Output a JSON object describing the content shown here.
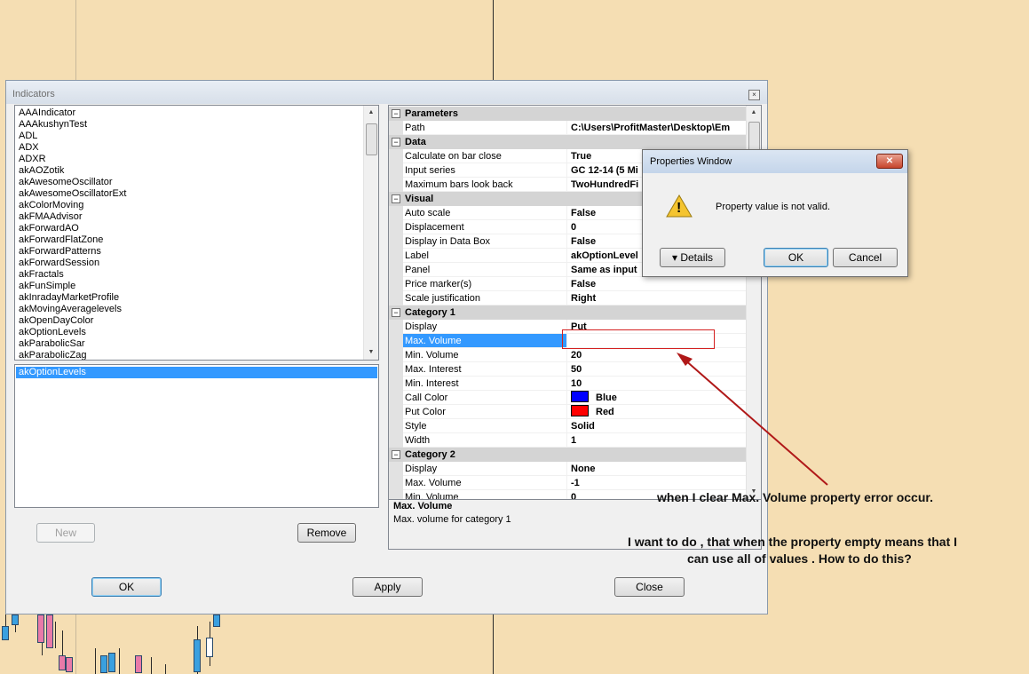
{
  "window": {
    "title": "Indicators",
    "close_glyph": "×"
  },
  "indicator_list": [
    "AAAIndicator",
    "AAAkushynTest",
    "ADL",
    "ADX",
    "ADXR",
    "akAOZotik",
    "akAwesomeOscillator",
    "akAwesomeOscillatorExt",
    "akColorMoving",
    "akFMAAdvisor",
    "akForwardAO",
    "akForwardFlatZone",
    "akForwardPatterns",
    "akForwardSession",
    "akFractals",
    "akFunSimple",
    "akInradayMarketProfile",
    "akMovingAveragelevels",
    "akOpenDayColor",
    "akOptionLevels",
    "akParabolicSar",
    "akParabolicZag"
  ],
  "selected_list": [
    "akOptionLevels"
  ],
  "buttons": {
    "new": "New",
    "remove": "Remove",
    "ok": "OK",
    "apply": "Apply",
    "close": "Close"
  },
  "property_grid": {
    "categories": {
      "parameters": "Parameters",
      "data": "Data",
      "visual": "Visual",
      "category1": "Category 1",
      "category2": "Category 2"
    },
    "toggle_glyph": "−",
    "rows": {
      "path": {
        "name": "Path",
        "value": "C:\\Users\\ProfitMaster\\Desktop\\Em"
      },
      "calc_on_bar_close": {
        "name": "Calculate on bar close",
        "value": "True"
      },
      "input_series": {
        "name": "Input series",
        "value": "GC 12-14 (5 Mi"
      },
      "max_bars_back": {
        "name": "Maximum bars look back",
        "value": "TwoHundredFi"
      },
      "auto_scale": {
        "name": "Auto scale",
        "value": "False"
      },
      "displacement": {
        "name": "Displacement",
        "value": "0"
      },
      "display_in_data_box": {
        "name": "Display in Data Box",
        "value": "False"
      },
      "label": {
        "name": "Label",
        "value": "akOptionLevel"
      },
      "panel": {
        "name": "Panel",
        "value": "Same as input"
      },
      "price_markers": {
        "name": "Price marker(s)",
        "value": "False"
      },
      "scale_justification": {
        "name": "Scale justification",
        "value": "Right"
      },
      "c1_display": {
        "name": "Display",
        "value": "Put"
      },
      "c1_max_volume": {
        "name": "Max. Volume",
        "value": ""
      },
      "c1_min_volume": {
        "name": "Min. Volume",
        "value": "20"
      },
      "c1_max_interest": {
        "name": "Max. Interest",
        "value": "50"
      },
      "c1_min_interest": {
        "name": "Min. Interest",
        "value": "10"
      },
      "c1_call_color": {
        "name": "Call Color",
        "value": "Blue",
        "color": "#0000ff"
      },
      "c1_put_color": {
        "name": "Put Color",
        "value": "Red",
        "color": "#ff0000"
      },
      "c1_style": {
        "name": "Style",
        "value": "Solid"
      },
      "c1_width": {
        "name": "Width",
        "value": "1"
      },
      "c2_display": {
        "name": "Display",
        "value": "None"
      },
      "c2_max_volume": {
        "name": "Max. Volume",
        "value": "-1"
      },
      "c2_min_volume": {
        "name": "Min. Volume",
        "value": "0"
      }
    }
  },
  "description": {
    "title": "Max. Volume",
    "text": "Max. volume for category 1"
  },
  "modal": {
    "title": "Properties Window",
    "close_glyph": "✕",
    "message": "Property value is not valid.",
    "warning_glyph": "!",
    "details_label": "Details",
    "details_glyph": "▾",
    "ok_label": "OK",
    "cancel_label": "Cancel"
  },
  "annotations": {
    "line1": "when I clear Max. Volume property error occur.",
    "line2": "I want to do , that when the property empty means that I",
    "line3": "can use all of values . How to do this?"
  },
  "scroll_glyphs": {
    "up": "▲",
    "down": "▼"
  },
  "colors": {
    "selection": "#3399ff",
    "chart_background": "#f5deb3",
    "annotation_arrow": "#b01818"
  }
}
